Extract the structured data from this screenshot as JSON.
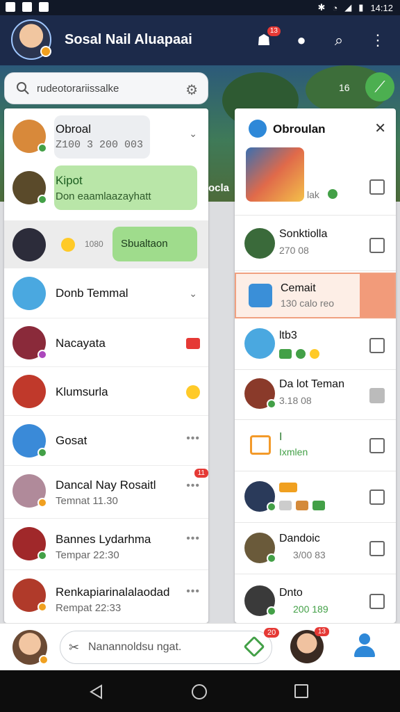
{
  "status_bar": {
    "time": "14:12"
  },
  "header": {
    "title": "Sosal Nail Aluapaai",
    "notification_count": "13",
    "icons": [
      "avatar",
      "people-icon",
      "bell-icon",
      "search-icon",
      "more-icon"
    ]
  },
  "search": {
    "placeholder": "rudeotorariissalke"
  },
  "scene": {
    "counter": "16",
    "overlay_text": "ocla"
  },
  "left_list": [
    {
      "name": "Obroal",
      "sub": "Z100 3 200 003"
    },
    {
      "name": "Kipot",
      "sub": "Don eaamlaazayhatt"
    },
    {
      "name": "Sbualtaon",
      "sub": "1080"
    },
    {
      "name": "Donb Temmal",
      "sub": ""
    },
    {
      "name": "Nacayata",
      "sub": ""
    },
    {
      "name": "Klumsurla",
      "sub": ""
    },
    {
      "name": "Gosat",
      "sub": ""
    },
    {
      "name": "Dancal Nay Rosaitl",
      "sub": "Temnat 11.30"
    },
    {
      "name": "Bannes Lydarhma",
      "sub": "Tempar 22:30"
    },
    {
      "name": "Renkapiarinalalaodad",
      "sub": "Rempat 22:33"
    }
  ],
  "right_panel": {
    "title": "Obroulan",
    "items": [
      {
        "name": "",
        "sub": "lak"
      },
      {
        "name": "Sonktiolla",
        "sub": "270 08"
      },
      {
        "name": "Cemait",
        "sub": "130 calo reo"
      },
      {
        "name": "ltb3",
        "sub": ""
      },
      {
        "name": "Da lot Teman",
        "sub": "3.18 08"
      },
      {
        "name": "I",
        "sub": "Ixmlen"
      },
      {
        "name": "",
        "sub": ""
      },
      {
        "name": "Dandoic",
        "sub": "3/00 83"
      },
      {
        "name": "Dnto",
        "sub": "200 189"
      }
    ]
  },
  "compose": {
    "placeholder": "Nanannoldsu ngat.",
    "badge": "20",
    "avatar_badge": "13"
  },
  "colors": {
    "header": "#1c2a4a",
    "accent_green": "#43a047",
    "accent_red": "#e53935",
    "accent_blue": "#2e88d8"
  }
}
